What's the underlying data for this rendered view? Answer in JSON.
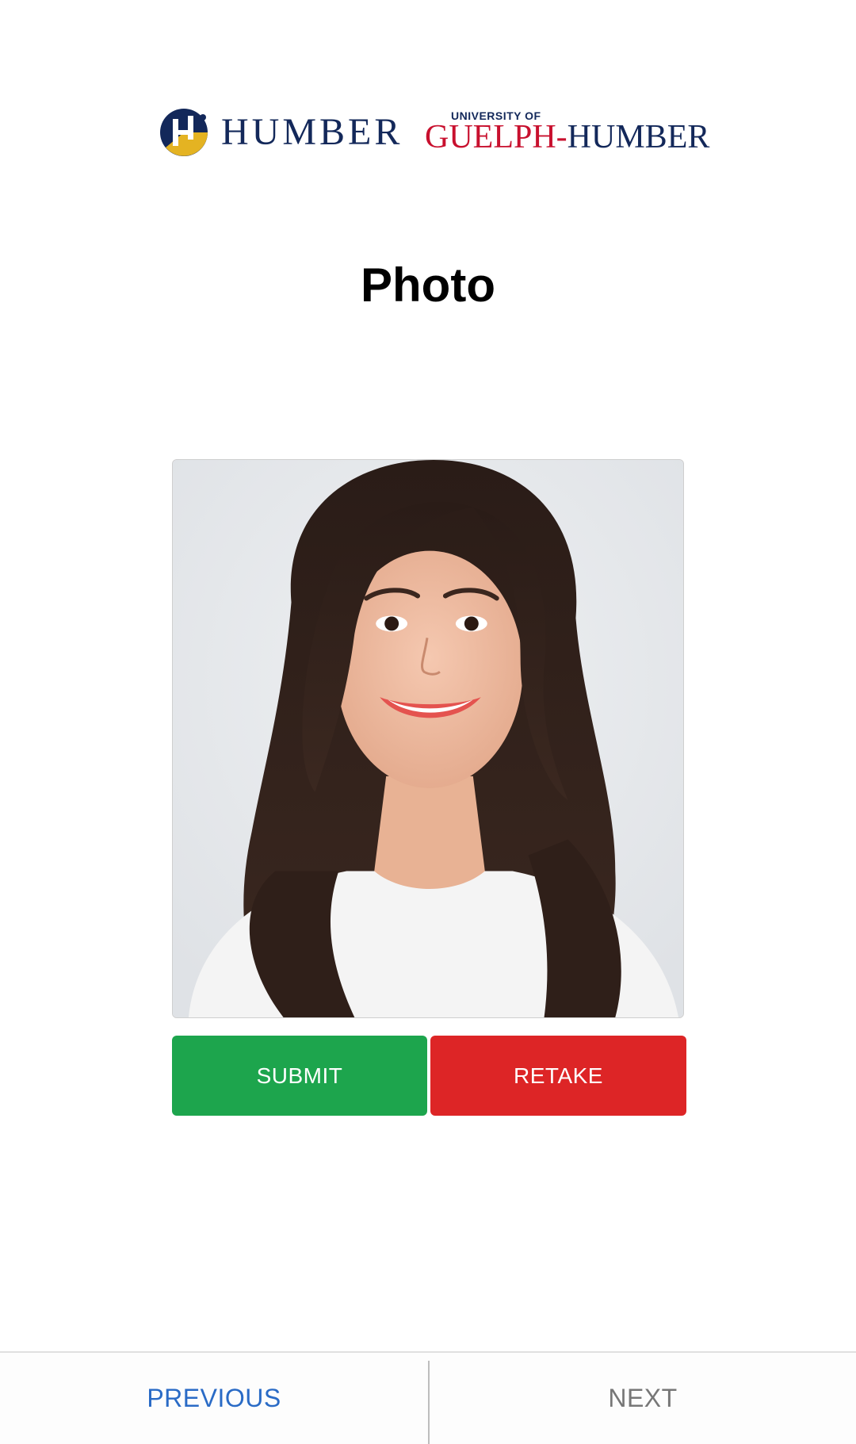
{
  "header": {
    "logo_humber_text": "HUMBER",
    "logo_guelph_top": "UNIVERSITY OF",
    "logo_guelph_left": "GUELPH",
    "logo_guelph_dash": "-",
    "logo_guelph_right": "HUMBER"
  },
  "page": {
    "title": "Photo"
  },
  "photo": {
    "icon": "portrait-photo"
  },
  "actions": {
    "submit_label": "SUBMIT",
    "retake_label": "RETAKE"
  },
  "nav": {
    "previous_label": "PREVIOUS",
    "next_label": "NEXT"
  },
  "colors": {
    "submit": "#1da54d",
    "retake": "#dd2526",
    "previous": "#2a6bc6",
    "next": "#777777",
    "humber_navy": "#13285a",
    "humber_gold": "#e4b322",
    "guelph_red": "#c8102e"
  }
}
